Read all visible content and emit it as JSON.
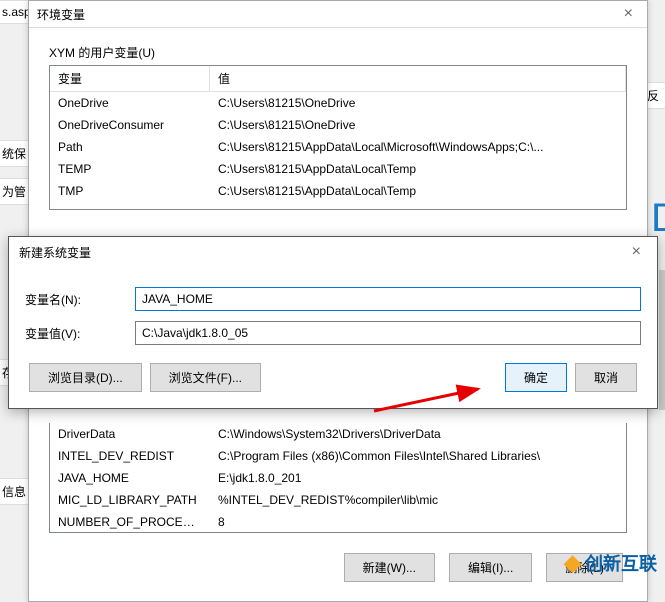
{
  "envWindow": {
    "title": "环境变量",
    "userSectionLabel": "XYM 的用户变量(U)",
    "tableHeaders": {
      "variable": "变量",
      "value": "值"
    },
    "userVars": [
      {
        "name": "OneDrive",
        "value": "C:\\Users\\81215\\OneDrive"
      },
      {
        "name": "OneDriveConsumer",
        "value": "C:\\Users\\81215\\OneDrive"
      },
      {
        "name": "Path",
        "value": "C:\\Users\\81215\\AppData\\Local\\Microsoft\\WindowsApps;C:\\..."
      },
      {
        "name": "TEMP",
        "value": "C:\\Users\\81215\\AppData\\Local\\Temp"
      },
      {
        "name": "TMP",
        "value": "C:\\Users\\81215\\AppData\\Local\\Temp"
      }
    ],
    "sysVars": [
      {
        "name": "DriverData",
        "value": "C:\\Windows\\System32\\Drivers\\DriverData"
      },
      {
        "name": "INTEL_DEV_REDIST",
        "value": "C:\\Program Files (x86)\\Common Files\\Intel\\Shared Libraries\\"
      },
      {
        "name": "JAVA_HOME",
        "value": "E:\\jdk1.8.0_201"
      },
      {
        "name": "MIC_LD_LIBRARY_PATH",
        "value": "%INTEL_DEV_REDIST%compiler\\lib\\mic"
      },
      {
        "name": "NUMBER_OF_PROCESSORS",
        "value": "8"
      }
    ],
    "bottomButtons": {
      "new": "新建(W)...",
      "edit": "编辑(I)...",
      "delete": "删除(L)"
    }
  },
  "newSysVarDialog": {
    "title": "新建系统变量",
    "nameLabel": "变量名(N):",
    "nameValue": "JAVA_HOME",
    "valueLabel": "变量值(V):",
    "valueValue": "C:\\Java\\jdk1.8.0_05",
    "buttons": {
      "browseDir": "浏览目录(D)...",
      "browseFile": "浏览文件(F)...",
      "ok": "确定",
      "cancel": "取消"
    }
  },
  "sideFragments": {
    "f1": "s.asp",
    "f2": "统保",
    "f3": "为管",
    "f4": "存储",
    "f5": "信息",
    "f6": "反"
  },
  "watermark": "创新互联",
  "accent": "D"
}
